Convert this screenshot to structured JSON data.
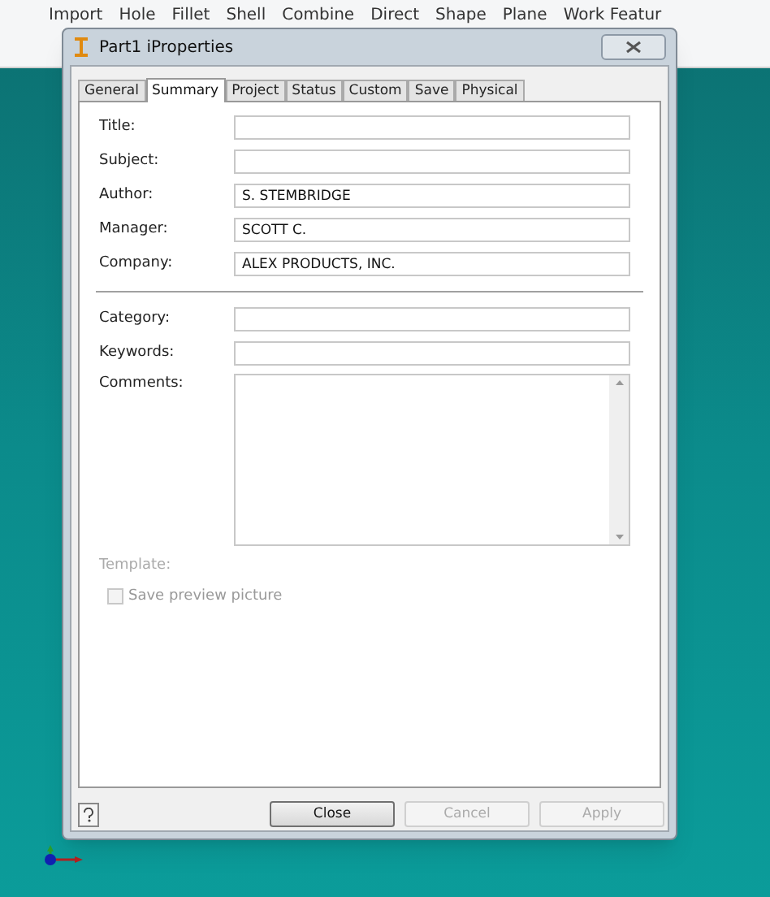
{
  "ribbon": {
    "items": [
      {
        "label": "Import"
      },
      {
        "label": "Hole"
      },
      {
        "label": "Fillet"
      },
      {
        "label": "Shell"
      },
      {
        "label": "Combine"
      },
      {
        "label": "Direct"
      },
      {
        "label": "Shape"
      },
      {
        "label": "Plane"
      },
      {
        "label": "Work Featur"
      }
    ]
  },
  "dialog": {
    "title": "Part1 iProperties",
    "tabs": [
      {
        "label": "General",
        "selected": false
      },
      {
        "label": "Summary",
        "selected": true
      },
      {
        "label": "Project",
        "selected": false
      },
      {
        "label": "Status",
        "selected": false
      },
      {
        "label": "Custom",
        "selected": false
      },
      {
        "label": "Save",
        "selected": false
      },
      {
        "label": "Physical",
        "selected": false
      }
    ],
    "fields": [
      {
        "kind": "text",
        "label": "Title:"
      },
      {
        "kind": "text",
        "label": "Subject:"
      },
      {
        "kind": "text",
        "label": "Author:",
        "value": "S. STEMBRIDGE"
      },
      {
        "kind": "text",
        "label": "Manager:",
        "value": "SCOTT C."
      },
      {
        "kind": "text",
        "label": "Company:",
        "value": "ALEX PRODUCTS, INC."
      },
      {
        "kind": "separator"
      },
      {
        "kind": "text",
        "label": "Category:"
      },
      {
        "kind": "text",
        "label": "Keywords:"
      },
      {
        "kind": "textarea",
        "label": "Comments:"
      }
    ],
    "template": {
      "label": "Template:",
      "disabled": true
    },
    "checkbox": {
      "label": "Save preview picture",
      "checked": false,
      "disabled": true
    },
    "buttons": [
      {
        "label": "Close",
        "disabled": false
      },
      {
        "label": "Cancel",
        "disabled": true
      },
      {
        "label": "Apply",
        "disabled": true
      }
    ]
  }
}
